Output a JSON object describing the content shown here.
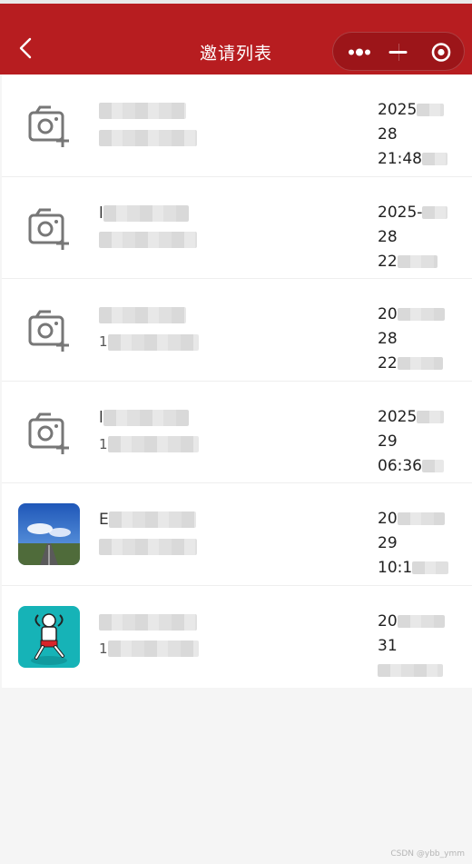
{
  "navbar": {
    "title": "邀请列表",
    "bg_color": "#b71d20"
  },
  "capsule": {
    "more_icon": "more-dots-icon",
    "minimize_icon": "minimize-icon",
    "close_icon": "target-circle-icon"
  },
  "list": [
    {
      "avatar": "camera-plus-icon",
      "name": "",
      "sub": "",
      "time": [
        "2025",
        "28",
        "21:48"
      ]
    },
    {
      "avatar": "camera-plus-icon",
      "name": "l",
      "sub": "",
      "time": [
        "2025-",
        "28",
        "22"
      ]
    },
    {
      "avatar": "camera-plus-icon",
      "name": "",
      "sub": "1",
      "time": [
        "20",
        "28",
        "22"
      ]
    },
    {
      "avatar": "camera-plus-icon",
      "name": "l",
      "sub": "1",
      "time": [
        "2025",
        "29",
        "06:36"
      ]
    },
    {
      "avatar": "sky-road-photo",
      "name": "E",
      "sub": "",
      "time": [
        "20",
        "29",
        "10:1"
      ]
    },
    {
      "avatar": "cartoon-photo",
      "name": "",
      "sub": "1",
      "time": [
        "20",
        "31",
        ""
      ]
    }
  ],
  "watermark": "CSDN @ybb_ymm"
}
